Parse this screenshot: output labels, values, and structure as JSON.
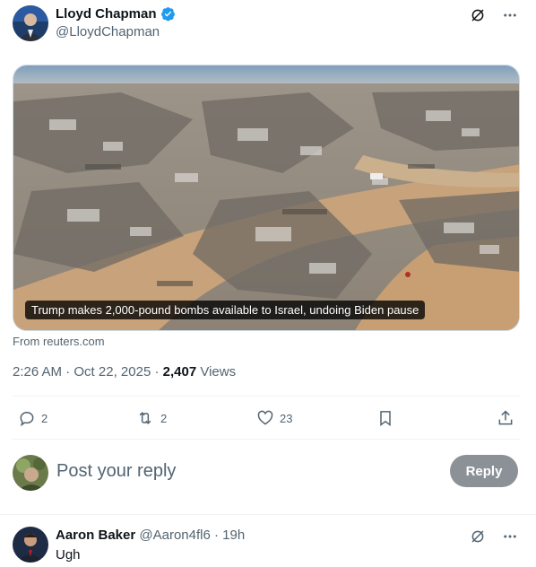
{
  "post": {
    "author_name": "Lloyd Chapman",
    "author_handle": "@LloydChapman",
    "media_caption": "Trump makes 2,000-pound bombs available to Israel, undoing Biden pause",
    "source": "From reuters.com",
    "time": "2:26 AM",
    "date": "Oct 22, 2025",
    "views_count": "2,407",
    "views_label": "Views",
    "actions": {
      "replies": "2",
      "reposts": "2",
      "likes": "23"
    }
  },
  "reply_box": {
    "placeholder": "Post your reply",
    "button_label": "Reply"
  },
  "comment": {
    "author_name": "Aaron Baker",
    "author_handle": "@Aaron4fl6",
    "age": "19h",
    "text": "Ugh"
  },
  "colors": {
    "text_primary": "#0f1419",
    "text_secondary": "#536471",
    "verified_blue": "#1d9bf0",
    "reply_button_disabled": "#8b9196"
  }
}
